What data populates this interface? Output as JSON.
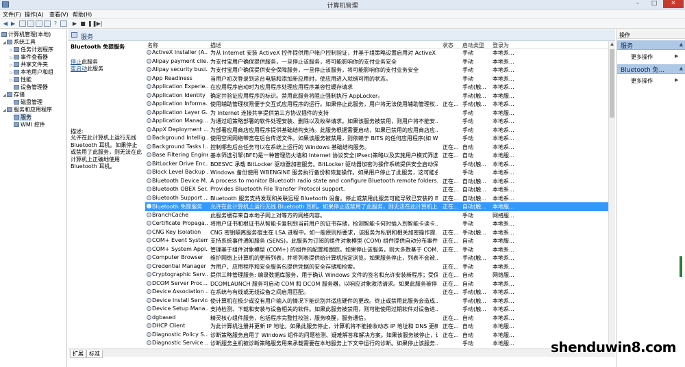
{
  "window": {
    "title": "计算机管理",
    "minimize": "–",
    "maximize": "□",
    "close": "✕"
  },
  "menu": [
    "文件(F)",
    "操作(A)",
    "查看(V)",
    "帮助(H)"
  ],
  "tree": {
    "root": "计算机管理(本地)",
    "system_tools": "系统工具",
    "task_scheduler": "任务计划程序",
    "event_viewer": "事件查看器",
    "shared_folders": "共享文件夹",
    "local_users": "本地用户和组",
    "performance": "性能",
    "device_manager": "设备管理器",
    "storage": "存储",
    "disk_management": "磁盘管理",
    "services_apps": "服务和应用程序",
    "services": "服务",
    "wmi": "WMI 控件"
  },
  "panel_title": "服务",
  "description_panel": {
    "service_name": "Bluetooth 免提服务",
    "stop_link": "停止",
    "stop_suffix": "此服务",
    "restart_link": "重启动",
    "restart_suffix": "此服务",
    "desc_label": "描述:",
    "desc_text": "允许在此计算机上运行无线 Bluetooth 耳机。如果停止或禁用了此服务，则无法在此计算机上正确地使用 Bluetooth 耳机。"
  },
  "columns": {
    "name": "名称",
    "desc": "描述",
    "status": "状态",
    "startup": "启动类型",
    "logon": "登录为"
  },
  "rows": [
    {
      "name": "ActiveX Installer (A...",
      "desc": "为从 Internet 安装 ActiveX 控件提供用户帐户控制验证，并基于组策略设置启用对 ActiveX ...",
      "status": "",
      "startup": "手动",
      "logon": "本地系..."
    },
    {
      "name": "Alipay payment clie...",
      "desc": "为支付宝用户确保提供服务，一旦停止该服务，将可能影响你的支付业务安全",
      "status": "",
      "startup": "手动",
      "logon": "本地系..."
    },
    {
      "name": "Alipay security busi...",
      "desc": "为支付宝用户确保提供安全保障服务，一旦停止该服务，将可能影响你的支付业务安全",
      "status": "",
      "startup": "手动",
      "logon": "本地系..."
    },
    {
      "name": "App Readiness",
      "desc": "当用户初次登录到这台电脑和添加新应用时，使应用进入就绪可用的状态。",
      "status": "",
      "startup": "手动",
      "logon": "本地系..."
    },
    {
      "name": "Application Experie...",
      "desc": "在应用程序启动时为应用程序处理应用程序兼容性缓存请求",
      "status": "",
      "startup": "手动(触...",
      "logon": "本地系..."
    },
    {
      "name": "Application Identity",
      "desc": "确定并验证应用程序的标识。禁用此服务将阻止强制执行 AppLocker。",
      "status": "",
      "startup": "手动(触...",
      "logon": "本地服..."
    },
    {
      "name": "Application Informa...",
      "desc": "使用辅助管理权限便于交互式应用程序的运行。如果停止此服务，用户将无法使用辅助管理权...",
      "status": "正在...",
      "startup": "手动(触...",
      "logon": "本地系..."
    },
    {
      "name": "Application Layer G...",
      "desc": "为 Internet 连接共享提供第三方协议插件的支持",
      "status": "",
      "startup": "手动",
      "logon": "本地服..."
    },
    {
      "name": "Application Manag...",
      "desc": "为通过组策略部署的软件处理安装、删除以及枚举请求。如果该服务被禁用，则用户将不能安...",
      "status": "",
      "startup": "手动",
      "logon": "本地系..."
    },
    {
      "name": "AppX Deployment ...",
      "desc": "为部署应用商店应用程序提供基础结构支持。此服务根据需要启动，如果已禁用的应用商店应...",
      "status": "",
      "startup": "手动",
      "logon": "本地系..."
    },
    {
      "name": "Background Intellig...",
      "desc": "使用空闲网络带宽在后台传送文件。如果该服务被禁用，则依赖于 BITS 的任何应用程序(如 Wi...",
      "status": "",
      "startup": "手动",
      "logon": "本地系..."
    },
    {
      "name": "Background Tasks I...",
      "desc": "控制哪些后台任务可以在系统上运行的 Windows 基础结构服务。",
      "status": "正在...",
      "startup": "自动",
      "logon": "本地系..."
    },
    {
      "name": "Base Filtering Engine",
      "desc": "基本筛选引擎(BFE)是一种管理防火墙和 Internet 协议安全(IPsec)策略以及实施用户模式筛选...",
      "status": "正在...",
      "startup": "自动",
      "logon": "本地服..."
    },
    {
      "name": "BitLocker Drive Enc...",
      "desc": "BDESVC 承载 BitLocker 驱动器加密服务。BitLocker 驱动器加密为操作系统提供安全启动保...",
      "status": "",
      "startup": "手动(触...",
      "logon": "本地系..."
    },
    {
      "name": "Block Level Backup ...",
      "desc": "Windows 备份使用 WBENGINE 服务执行备份和恢复操作。如果用户停止了此服务，这可能会...",
      "status": "",
      "startup": "手动",
      "logon": "本地系..."
    },
    {
      "name": "Bluetooth Device M...",
      "desc": "A process to monitor Bluetooth radio state and configure Bluetooth remote folders.",
      "status": "正在...",
      "startup": "自动(触...",
      "logon": "本地系..."
    },
    {
      "name": "Bluetooth OBEX Ser...",
      "desc": "Provides Bluetooth File Transfer Protocol support.",
      "status": "正在...",
      "startup": "自动(触...",
      "logon": "本地系..."
    },
    {
      "name": "Bluetooth Support ...",
      "desc": "Bluetooth 服务支持发现和关联远程 Bluetooth 设备。停止或禁用此服务可能导致已安装的 Bl...",
      "status": "正在...",
      "startup": "自动(触...",
      "logon": "本地系..."
    },
    {
      "name": "Bluetooth 免提服务",
      "desc": "允许在此计算机上运行无线 Bluetooth 耳机。如果停止或禁用了此服务，则无法在此计算机上...",
      "status": "正在...",
      "startup": "自动(触...",
      "logon": "本地服..."
    },
    {
      "name": "BranchCache",
      "desc": "此服务缓存来自本地子网上对等方的网络内容。",
      "status": "",
      "startup": "手动",
      "logon": "网络服..."
    },
    {
      "name": "Certificate Propaga...",
      "desc": "将用户证书和根证书从智能卡复制到当前用户的证书存储，检测智能卡何时插入到智能卡读卡...",
      "status": "",
      "startup": "手动",
      "logon": "本地系..."
    },
    {
      "name": "CNG Key Isolation",
      "desc": "CNG 密钥隔离服务宿主在 LSA 进程中。如一般原则所要求，该服务为私钥和相关加密操作提...",
      "status": "正在...",
      "startup": "手动(触...",
      "logon": "本地系..."
    },
    {
      "name": "COM+ Event System",
      "desc": "支持系统事件通知服务 (SENS)，此服务为订阅的组件对象模型 (COM) 组件提供自动分布事件...",
      "status": "正在...",
      "startup": "自动",
      "logon": "本地服..."
    },
    {
      "name": "COM+ System Appl...",
      "desc": "管理基于组件对象模型 (COM+) 的组件的配置和跟踪。如果停止该服务，则大多数基于 COM...",
      "status": "正在...",
      "startup": "手动",
      "logon": "本地系..."
    },
    {
      "name": "Computer Browser",
      "desc": "维护网络上计算机的更新列表，并将列表提供给计算机指定浏览。如果服务停止，列表不会被...",
      "status": "",
      "startup": "手动(触...",
      "logon": "本地系..."
    },
    {
      "name": "Credential Manager",
      "desc": "为用户、应用程序和安全服务包提供凭据的安全存储和检索。",
      "status": "正在...",
      "startup": "手动",
      "logon": "本地系..."
    },
    {
      "name": "Cryptographic Serv...",
      "desc": "提供三种管理服务: 编录数据库服务，用于确认 Windows 文件的签名和允许安装新程序；受保...",
      "status": "正在...",
      "startup": "自动",
      "logon": "网络服..."
    },
    {
      "name": "DCOM Server Proc...",
      "desc": "DCOMLAUNCH 服务可启动 COM 和 DCOM 服务器，以响应对象激活请求。如果此服务被停...",
      "status": "正在...",
      "startup": "自动",
      "logon": "本地系..."
    },
    {
      "name": "Device Association ...",
      "desc": "在系统与有线或无线设备之间启用匹配。",
      "status": "正在...",
      "startup": "手动(触...",
      "logon": "本地系..."
    },
    {
      "name": "Device Install Service",
      "desc": "使计算机在极少或没有用户输入的情况下能识别并适应硬件的更改。终止或禁用此服务会造成...",
      "status": "",
      "startup": "手动(触...",
      "logon": "本地系..."
    },
    {
      "name": "Device Setup Mana...",
      "desc": "支持检测、下载和安装与设备相关的软件。如果此服务被禁用，则可能使用过期软件对设备进...",
      "status": "",
      "startup": "手动(触...",
      "logon": "本地系..."
    },
    {
      "name": "dgbased",
      "desc": "精灵核心组件服务，包括程序完整性校验，服务唤醒，服务通信。",
      "status": "正在...",
      "startup": "自动",
      "logon": "本地系..."
    },
    {
      "name": "DHCP Client",
      "desc": "为此计算机注册并更新 IP 地址。如果此服务停止，计算机将不能接收动态 IP 地址和 DNS 更新...",
      "status": "正在...",
      "startup": "自动",
      "logon": "本地服..."
    },
    {
      "name": "Diagnostic Policy S...",
      "desc": "诊断策略服务启用了 Windows 组件的问题检测、疑难解答和解决方案。如果该服务被停止，诊...",
      "status": "正在...",
      "startup": "自动",
      "logon": "本地服..."
    },
    {
      "name": "Diagnostic Service ...",
      "desc": "诊断服务主机被诊断策略服务用来承载需要在本地服务上下文中运行的诊断。如果停止该服务...",
      "status": "",
      "startup": "手动",
      "logon": "本地服..."
    }
  ],
  "selected_row": 18,
  "tabs": [
    "扩展",
    "标准"
  ],
  "actions": {
    "header": "操作",
    "section1": "服务",
    "section1_more": "更多操作",
    "section2": "Bluetooth 免...",
    "section2_more": "更多操作"
  },
  "watermark": "shenduwin8.com",
  "colors": {
    "selection": "#3399ff",
    "action_header": "#aec8e6",
    "link": "#1a53a0"
  }
}
